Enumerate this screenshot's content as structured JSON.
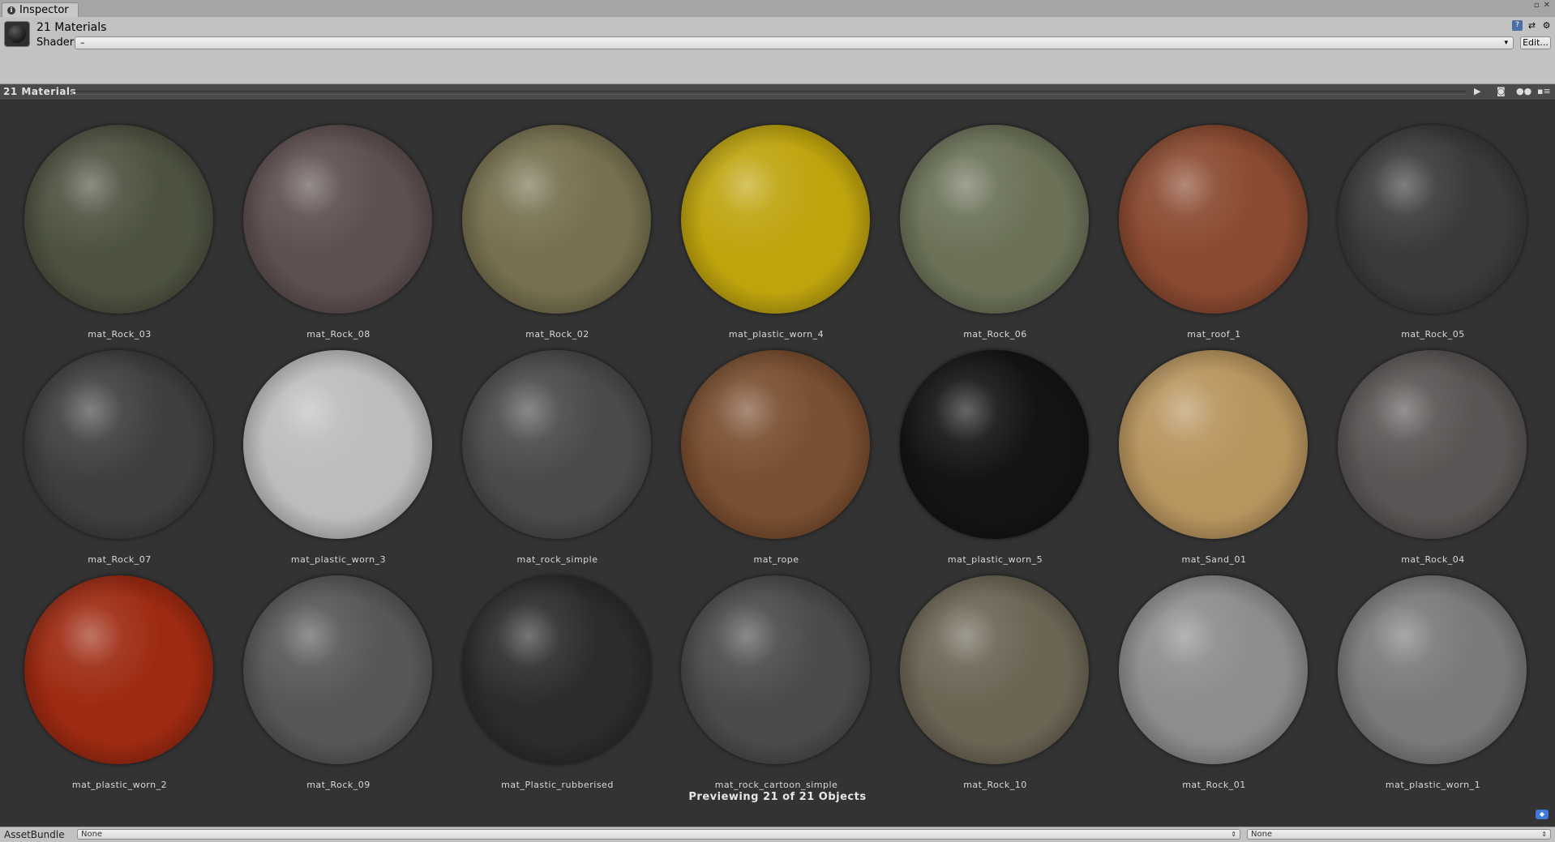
{
  "window": {
    "tab_label": "Inspector",
    "controls": [
      "▫",
      "✕"
    ]
  },
  "header": {
    "title": "21 Materials",
    "shader_label": "Shader",
    "shader_value": "–",
    "edit_button": "Edit..."
  },
  "preview": {
    "title": "21 Materials",
    "footer": "Previewing 21 of 21 Objects"
  },
  "materials": [
    {
      "name": "mat_Rock_03",
      "color": "#4d5240"
    },
    {
      "name": "mat_Rock_08",
      "color": "#5e4f50"
    },
    {
      "name": "mat_Rock_02",
      "color": "#76704f"
    },
    {
      "name": "mat_plastic_worn_4",
      "color": "#bfa40e"
    },
    {
      "name": "mat_Rock_06",
      "color": "#6b7258"
    },
    {
      "name": "mat_roof_1",
      "color": "#8a4a30"
    },
    {
      "name": "mat_Rock_05",
      "color": "#3a3a3c"
    },
    {
      "name": "mat_Rock_07",
      "color": "#3f3f3f"
    },
    {
      "name": "mat_plastic_worn_3",
      "color": "#bdbdbd"
    },
    {
      "name": "mat_rock_simple",
      "color": "#4a4a4a"
    },
    {
      "name": "mat_rope",
      "color": "#7a4e30"
    },
    {
      "name": "mat_plastic_worn_5",
      "color": "#141414"
    },
    {
      "name": "mat_Sand_01",
      "color": "#b8955f"
    },
    {
      "name": "mat_Rock_04",
      "color": "#5a5554"
    },
    {
      "name": "mat_plastic_worn_2",
      "color": "#9e2a12"
    },
    {
      "name": "mat_Rock_09",
      "color": "#575757"
    },
    {
      "name": "mat_Plastic_rubberised",
      "color": "#2c2c2c"
    },
    {
      "name": "mat_rock_cartoon_simple",
      "color": "#4b4b4b"
    },
    {
      "name": "mat_Rock_10",
      "color": "#6b6554"
    },
    {
      "name": "mat_Rock_01",
      "color": "#8d8d8d"
    },
    {
      "name": "mat_plastic_worn_1",
      "color": "#7a7a7a"
    }
  ],
  "asset_bundle": {
    "label": "AssetBundle",
    "bundle_value": "None",
    "variant_value": "None"
  }
}
